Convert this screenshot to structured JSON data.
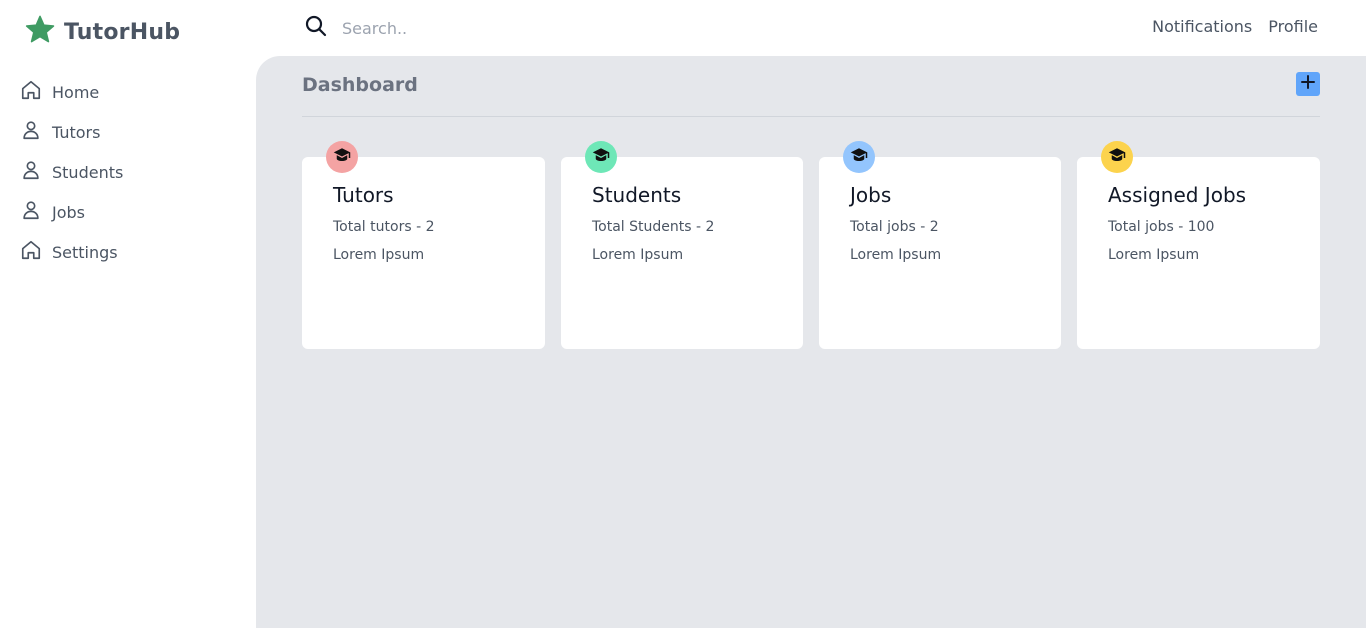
{
  "brand": {
    "name": "TutorHub",
    "icon": "star-icon",
    "color": "#3f9b63"
  },
  "sidebar": {
    "items": [
      {
        "label": "Home",
        "icon": "home-icon"
      },
      {
        "label": "Tutors",
        "icon": "user-icon"
      },
      {
        "label": "Students",
        "icon": "user-icon"
      },
      {
        "label": "Jobs",
        "icon": "user-icon"
      },
      {
        "label": "Settings",
        "icon": "home-icon"
      }
    ]
  },
  "header": {
    "search_placeholder": "Search..",
    "notifications_label": "Notifications",
    "profile_label": "Profile"
  },
  "main": {
    "title": "Dashboard",
    "add_icon": "plus-icon",
    "cards": [
      {
        "title": "Tutors",
        "stat": "Total tutors - 2",
        "desc": "Lorem Ipsum",
        "icon": "graduation-cap-icon",
        "color": "#f4a3a3"
      },
      {
        "title": "Students",
        "stat": "Total Students - 2",
        "desc": "Lorem Ipsum",
        "icon": "graduation-cap-icon",
        "color": "#6ee7b7"
      },
      {
        "title": "Jobs",
        "stat": "Total jobs - 2",
        "desc": "Lorem Ipsum",
        "icon": "graduation-cap-icon",
        "color": "#93c5fd"
      },
      {
        "title": "Assigned Jobs",
        "stat": "Total jobs - 100",
        "desc": "Lorem Ipsum",
        "icon": "graduation-cap-icon",
        "color": "#fcd34d"
      }
    ]
  }
}
